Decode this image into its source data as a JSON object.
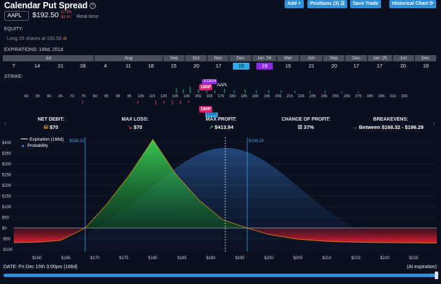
{
  "header": {
    "title": "Calendar Put Spread",
    "ticker": "AAPL",
    "price": "$192.50",
    "change_pct": "-0.73%",
    "change_abs": "-$1.41",
    "realtime": "Real-time"
  },
  "toolbar": {
    "add": "Add +",
    "positions": "Positions (3) ☰",
    "save": "Save Trade",
    "historical": "Historical Chart ⟳"
  },
  "equity": {
    "label": "EQUITY:",
    "value": "Long 25 shares at 192.50"
  },
  "expirations": {
    "label": "EXPIRATIONS: 166d, 201d",
    "months": [
      "Jul",
      "Aug",
      "Sep",
      "Oct",
      "Nov",
      "Dec",
      "Jan '24",
      "Mar",
      "Jun",
      "Sep",
      "Dec",
      "Jan '25",
      "Jun",
      "Dec"
    ],
    "days": [
      "7",
      "14",
      "21",
      "28",
      "4",
      "11",
      "18",
      "15",
      "20",
      "17",
      "15",
      "19",
      "15",
      "21",
      "20",
      "17",
      "17",
      "20",
      "19"
    ],
    "selected_days": [
      "15",
      "19"
    ]
  },
  "strike": {
    "label": "STRIKE:",
    "ticks": [
      "50",
      "55",
      "60",
      "65",
      "70",
      "75",
      "80",
      "85",
      "90",
      "95",
      "105",
      "115",
      "125",
      "135",
      "145",
      "155",
      "165",
      "175",
      "180",
      "185",
      "190",
      "195",
      "205",
      "215",
      "225",
      "235",
      "245",
      "255",
      "265",
      "275",
      "285",
      "295",
      "310",
      "320"
    ],
    "upper_tag": "180P",
    "upper_date": "1/19/24",
    "lower_tag": "180P",
    "lower_date": "12/15",
    "aapl_marker": "AAPL"
  },
  "stats": {
    "net_debit": {
      "label": "NET DEBIT:",
      "value": "$70"
    },
    "max_loss": {
      "label": "MAX LOSS:",
      "value": "$70"
    },
    "max_profit": {
      "label": "MAX PROFIT:",
      "value": "$413.94"
    },
    "chance": {
      "label": "CHANCE OF PROFIT:",
      "value": "37%"
    },
    "breakevens": {
      "label": "BREAKEVENS:",
      "value": "Between $168.32 - $196.29"
    }
  },
  "legend": {
    "expiration": "Expiration (166d)",
    "probability": "Probability"
  },
  "chart_data": {
    "type": "area",
    "x_ticks": [
      "$160",
      "$165",
      "$170",
      "$175",
      "$180",
      "$185",
      "$190",
      "$195",
      "$200",
      "$205",
      "$210",
      "$215",
      "$220",
      "$225"
    ],
    "y_ticks": [
      "$400",
      "$350",
      "$300",
      "$250",
      "$200",
      "$150",
      "$100",
      "$50",
      "$0",
      "-$50",
      "-$100"
    ],
    "ylim": [
      -110,
      425
    ],
    "xlim": [
      156,
      229
    ],
    "breakeven_labels": [
      "$168.32",
      "$196.29"
    ],
    "breakevens": [
      168.32,
      196.29
    ],
    "current_price": 192.5,
    "series": [
      {
        "x": [
          156,
          160,
          164,
          168.32,
          172,
          176,
          180,
          184,
          188,
          192,
          196.29,
          200,
          205,
          210,
          215,
          220,
          225,
          229
        ],
        "values": [
          -68,
          -66,
          -58,
          0,
          110,
          250,
          414,
          250,
          130,
          40,
          0,
          -30,
          -52,
          -62,
          -66,
          -68,
          -69,
          -70
        ]
      }
    ],
    "probability": {
      "mean": 192.5,
      "sd": 13
    }
  },
  "footer": {
    "date": "DATE: Fri Dec 15th 3:00pm (166d)",
    "at_expiration": "(At expiration)"
  },
  "colors": {
    "accent": "#2f8fd8",
    "profit": "#22c55e",
    "loss": "#ef4444",
    "put_tag": "#d6246e"
  }
}
